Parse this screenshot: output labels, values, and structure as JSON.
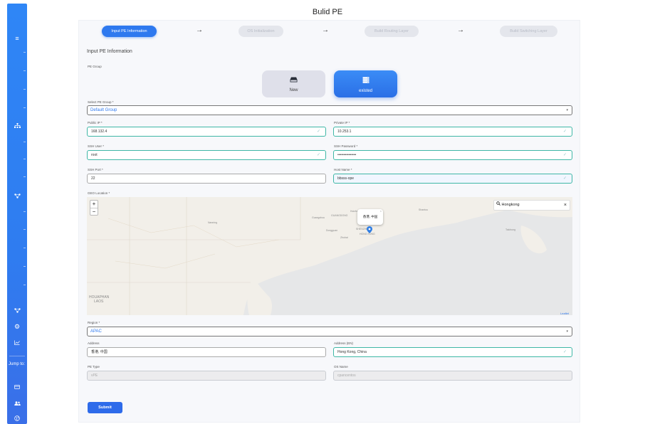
{
  "page_title": "Bulid PE",
  "sidebar": {
    "jump_label": "Jump to:",
    "icons": [
      "menu-icon",
      "sitemap-icon",
      "network-icon",
      "network-icon-2",
      "settings-cogs-icon",
      "chart-icon",
      "card-icon",
      "users-icon",
      "globe-icon"
    ]
  },
  "steps": [
    {
      "label": "Input PE Information",
      "state": "active"
    },
    {
      "label": "OS Initialization",
      "state": "inactive"
    },
    {
      "label": "Build Routing Layer",
      "state": "inactive"
    },
    {
      "label": "Build Switching Layer",
      "state": "inactive"
    }
  ],
  "section_title": "Input PE Information",
  "pe_group": {
    "label": "PE Group",
    "options": [
      {
        "label": "New",
        "icon": "drive-icon",
        "selected": false
      },
      {
        "label": "existed",
        "icon": "server-icon",
        "selected": true
      }
    ]
  },
  "select_pe_group": {
    "label": "Select PE Group *",
    "value": "Default Group"
  },
  "public_ip": {
    "label": "Public IP *",
    "value": "168.132.4"
  },
  "private_ip": {
    "label": "Private IP *",
    "value": "10.253.1"
  },
  "ssh_user": {
    "label": "SSH User *",
    "value": "root"
  },
  "ssh_password": {
    "label": "SSH Password *",
    "value": "•••••••••••••••"
  },
  "ssh_port": {
    "label": "SSH Port *",
    "value": "22"
  },
  "host_name": {
    "label": "Host Name *",
    "value": "bbsss-ope"
  },
  "geo_location": {
    "label": "GEO Location *",
    "search_value": "Hongkong",
    "popup_text": "香港, 中国",
    "attribution": "Leaflet",
    "place_labels": [
      "GUANGDONG",
      "SHENZHEN",
      "HONG KONG",
      "HOUAPHAN",
      "LAOS",
      "Zhuhai",
      "Shantou",
      "Guangzhou",
      "Dongguan",
      "Huizhou",
      "Taichung",
      "Nanning"
    ]
  },
  "region": {
    "label": "Region *",
    "value": "APAC"
  },
  "address": {
    "label": "Address",
    "value": "香港, 中国"
  },
  "address_en": {
    "label": "Address (EN)",
    "value": "Hong Kong, China"
  },
  "pe_type": {
    "label": "PE Type",
    "value": "vPE"
  },
  "os_name": {
    "label": "OS Name",
    "value": "cpancentos"
  },
  "submit_label": "Submit",
  "colors": {
    "primary": "#2e79ef",
    "valid_border": "#3fb7a6",
    "sidebar": "#2f86f6"
  }
}
